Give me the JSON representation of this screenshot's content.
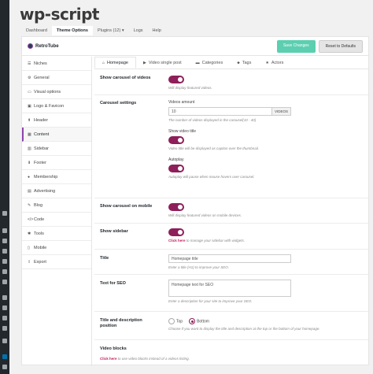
{
  "app": {
    "logo": "wp-script"
  },
  "topnav": [
    {
      "label": "Dashboard",
      "active": false
    },
    {
      "label": "Theme Options",
      "active": true
    },
    {
      "label": "Plugins (12) ▾",
      "active": false
    },
    {
      "label": "Logs",
      "active": false
    },
    {
      "label": "Help",
      "active": false
    }
  ],
  "panel": {
    "brand": "RetroTube",
    "save_label": "Save Changes",
    "reset_label": "Reset to Defaults"
  },
  "sidemenu": [
    {
      "icon": "☰",
      "icon_name": "list-icon",
      "label": "Niches"
    },
    {
      "icon": "⚙",
      "icon_name": "gear-icon",
      "label": "General"
    },
    {
      "icon": "▭",
      "icon_name": "monitor-icon",
      "label": "Visual options"
    },
    {
      "icon": "▣",
      "icon_name": "image-icon",
      "label": "Logo & Favicon"
    },
    {
      "icon": "⬆",
      "icon_name": "arrow-up-icon",
      "label": "Header"
    },
    {
      "icon": "▦",
      "icon_name": "grid-icon",
      "label": "Content",
      "active": true
    },
    {
      "icon": "▥",
      "icon_name": "columns-icon",
      "label": "Sidebar"
    },
    {
      "icon": "⬇",
      "icon_name": "arrow-down-icon",
      "label": "Footer"
    },
    {
      "icon": "●",
      "icon_name": "user-icon",
      "label": "Membership"
    },
    {
      "icon": "▤",
      "icon_name": "ad-icon",
      "label": "Advertising"
    },
    {
      "icon": "✎",
      "icon_name": "pencil-icon",
      "label": "Blog"
    },
    {
      "icon": "</>",
      "icon_name": "code-icon",
      "label": "Code"
    },
    {
      "icon": "✱",
      "icon_name": "wrench-icon",
      "label": "Tools"
    },
    {
      "icon": "▯",
      "icon_name": "mobile-icon",
      "label": "Mobile"
    },
    {
      "icon": "⇪",
      "icon_name": "export-icon",
      "label": "Export"
    }
  ],
  "subtabs": [
    {
      "icon": "⌂",
      "icon_name": "home-icon",
      "label": "Homepage",
      "active": true
    },
    {
      "icon": "▶",
      "icon_name": "play-icon",
      "label": "Video single post"
    },
    {
      "icon": "▬",
      "icon_name": "folder-icon",
      "label": "Categories"
    },
    {
      "icon": "⬥",
      "icon_name": "tag-icon",
      "label": "Tags"
    },
    {
      "icon": "★",
      "icon_name": "star-icon",
      "label": "Actors"
    }
  ],
  "settings": {
    "carousel_videos": {
      "label": "Show carousel of videos",
      "desc": "Will display featured videos."
    },
    "carousel_settings": {
      "label": "Carousel settings",
      "videos_amount_label": "Videos amount",
      "videos_amount_value": "10",
      "videos_amount_addon": "VIDEOS",
      "videos_amount_desc": "The number of videos displayed in the carousel(10 - 40)",
      "show_title_label": "Show video title",
      "show_title_desc": "Video title will be displayed as caption over the thumbnail.",
      "autoplay_label": "Autoplay",
      "autoplay_desc": "Autoplay will pause when mouse hovers over carousel."
    },
    "carousel_mobile": {
      "label": "Show carousel on mobile",
      "desc": "Will display featured videos on mobile devices."
    },
    "show_sidebar": {
      "label": "Show sidebar",
      "link": "Click here",
      "desc": " to manage your sidebar with widgets."
    },
    "title": {
      "label": "Title",
      "value": "Homepage title",
      "desc": "Enter a title (H1) to improve your SEO."
    },
    "text_seo": {
      "label": "Text for SEO",
      "value": "Homepage text for SEO",
      "desc": "Enter a description for your site to improve your SEO."
    },
    "title_position": {
      "label": "Title and description position",
      "options": [
        "Top",
        "Bottom"
      ],
      "selected": "Bottom",
      "desc": "Choose if you want to display the title and description at the top or the bottom of your homepage."
    },
    "video_blocks": {
      "label": "Video blocks",
      "link": "Click here",
      "desc": " to use video blocks instead of a videos listing."
    }
  },
  "colors": {
    "accent": "#8e1f5a",
    "save": "#5ccfb0",
    "link": "#c2185b"
  }
}
